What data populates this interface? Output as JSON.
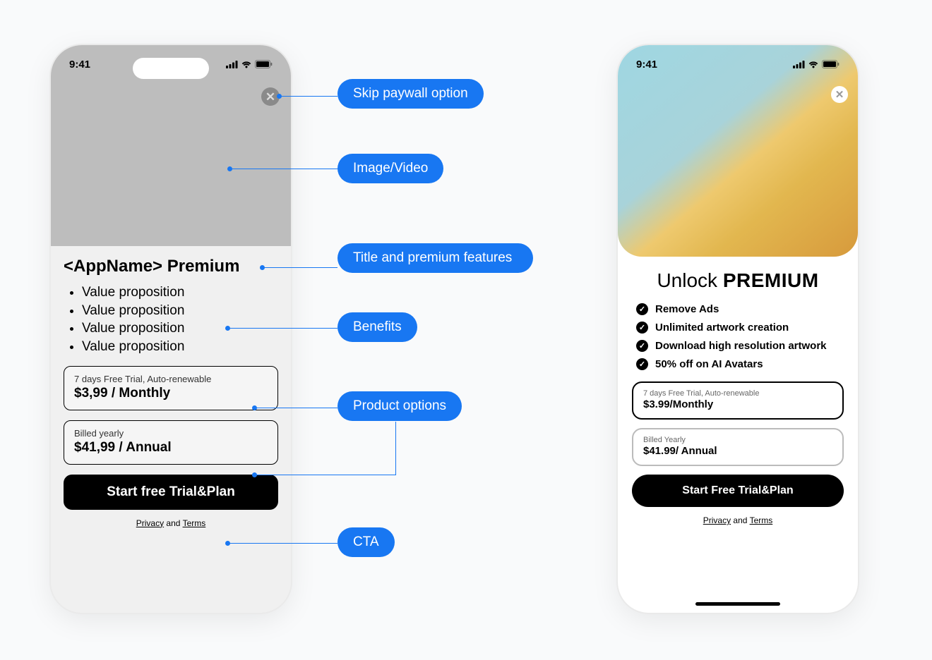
{
  "status_time": "9:41",
  "left_phone": {
    "title": "<AppName> Premium",
    "bullets": [
      "Value proposition",
      "Value proposition",
      "Value proposition",
      "Value proposition"
    ],
    "plan_monthly": {
      "sub": "7 days Free Trial, Auto-renewable",
      "price": "$3,99 / Monthly"
    },
    "plan_annual": {
      "sub": "Billed yearly",
      "price": "$41,99 / Annual"
    },
    "cta": "Start free Trial&Plan",
    "footer_privacy": "Privacy",
    "footer_and": " and ",
    "footer_terms": "Terms"
  },
  "right_phone": {
    "title_light": "Unlock ",
    "title_bold": "PREMIUM",
    "benefits": [
      "Remove Ads",
      "Unlimited artwork creation",
      "Download high resolution artwork",
      "50% off on AI Avatars"
    ],
    "plan_monthly": {
      "sub": "7 days Free Trial, Auto-renewable",
      "price": "$3.99/Monthly"
    },
    "plan_annual": {
      "sub": "Billed Yearly",
      "price": "$41.99/ Annual"
    },
    "cta": "Start Free Trial&Plan",
    "footer_privacy": "Privacy",
    "footer_and": " and ",
    "footer_terms": "Terms"
  },
  "annotations": {
    "skip": "Skip paywall option",
    "image": "Image/Video",
    "title_features": "Title and premium features",
    "benefits": "Benefits",
    "products": "Product options",
    "cta": "CTA"
  }
}
